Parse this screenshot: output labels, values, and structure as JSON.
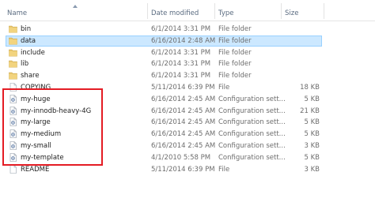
{
  "columns": {
    "name": "Name",
    "date": "Date modified",
    "type": "Type",
    "size": "Size"
  },
  "files": [
    {
      "name": "bin",
      "date": "6/1/2014 3:31 PM",
      "type": "File folder",
      "size": "",
      "icon": "folder-icon",
      "selected": false
    },
    {
      "name": "data",
      "date": "6/16/2014 2:48 AM",
      "type": "File folder",
      "size": "",
      "icon": "folder-icon",
      "selected": true
    },
    {
      "name": "include",
      "date": "6/1/2014 3:31 PM",
      "type": "File folder",
      "size": "",
      "icon": "folder-icon",
      "selected": false
    },
    {
      "name": "lib",
      "date": "6/1/2014 3:31 PM",
      "type": "File folder",
      "size": "",
      "icon": "folder-icon",
      "selected": false
    },
    {
      "name": "share",
      "date": "6/1/2014 3:31 PM",
      "type": "File folder",
      "size": "",
      "icon": "folder-icon",
      "selected": false
    },
    {
      "name": "COPYING",
      "date": "5/11/2014 6:39 PM",
      "type": "File",
      "size": "18 KB",
      "icon": "file-icon",
      "selected": false
    },
    {
      "name": "my-huge",
      "date": "6/16/2014 2:45 AM",
      "type": "Configuration sett...",
      "size": "5 KB",
      "icon": "config-file-icon",
      "selected": false
    },
    {
      "name": "my-innodb-heavy-4G",
      "date": "6/16/2014 2:45 AM",
      "type": "Configuration sett...",
      "size": "21 KB",
      "icon": "config-file-icon",
      "selected": false
    },
    {
      "name": "my-large",
      "date": "6/16/2014 2:45 AM",
      "type": "Configuration sett...",
      "size": "5 KB",
      "icon": "config-file-icon",
      "selected": false
    },
    {
      "name": "my-medium",
      "date": "6/16/2014 2:45 AM",
      "type": "Configuration sett...",
      "size": "5 KB",
      "icon": "config-file-icon",
      "selected": false
    },
    {
      "name": "my-small",
      "date": "6/16/2014 2:45 AM",
      "type": "Configuration sett...",
      "size": "3 KB",
      "icon": "config-file-icon",
      "selected": false
    },
    {
      "name": "my-template",
      "date": "4/1/2010 5:58 PM",
      "type": "Configuration sett...",
      "size": "5 KB",
      "icon": "config-file-icon",
      "selected": false
    },
    {
      "name": "README",
      "date": "5/11/2014 6:39 PM",
      "type": "File",
      "size": "3 KB",
      "icon": "file-icon",
      "selected": false
    }
  ],
  "colors": {
    "selection_bg": "#cce8ff",
    "selection_border": "#99d1ff",
    "highlight_box": "#e41c24",
    "folder": "#e8c46a",
    "header_text": "#5a6b80"
  }
}
